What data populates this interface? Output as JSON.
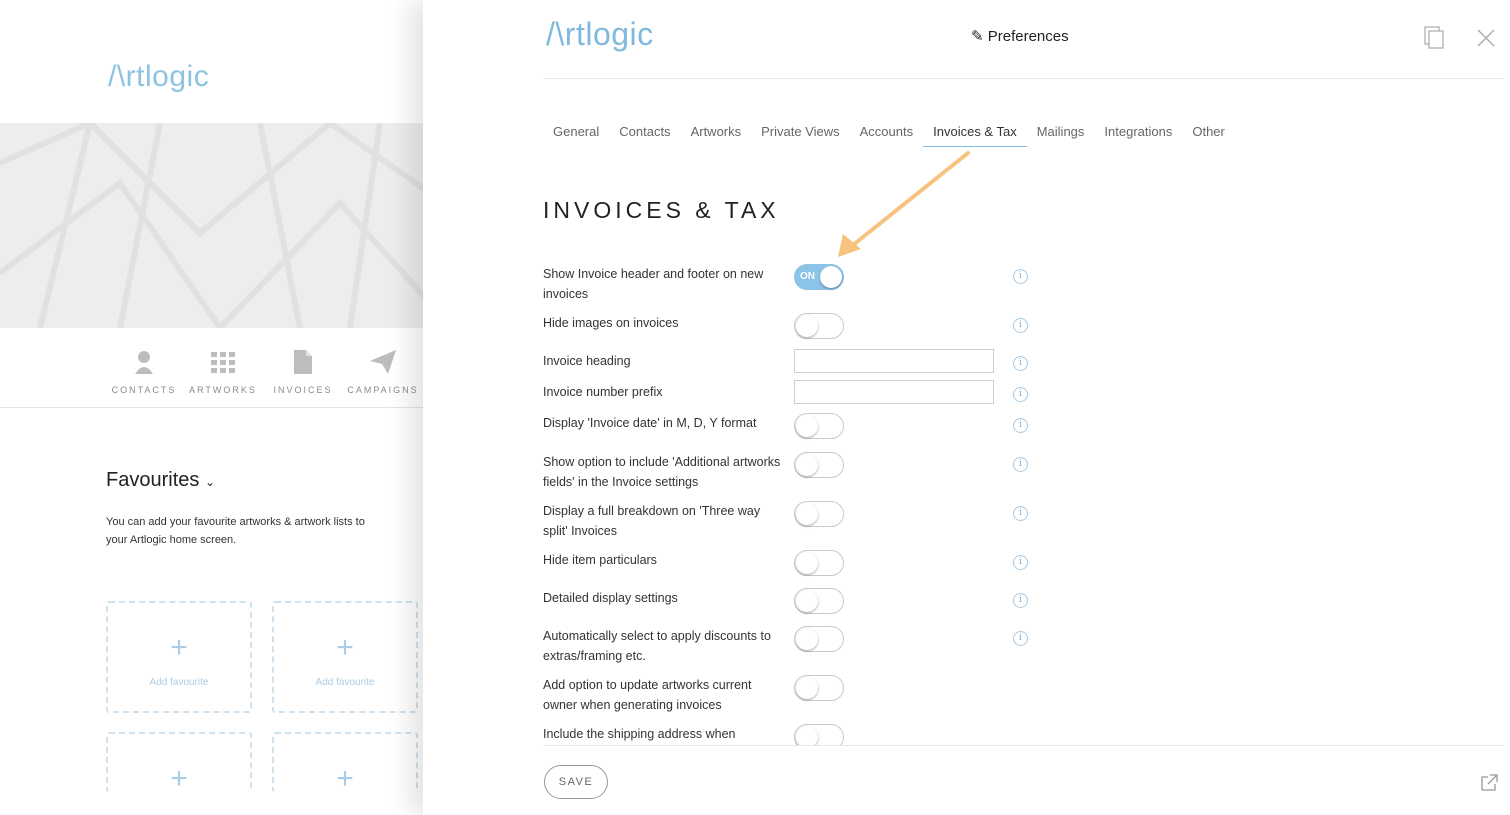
{
  "background_app": {
    "logo": "/\\rtlogic",
    "nav": [
      {
        "label": "CONTACTS",
        "icon": "person-icon"
      },
      {
        "label": "ARTWORKS",
        "icon": "grid-icon"
      },
      {
        "label": "INVOICES",
        "icon": "document-icon"
      },
      {
        "label": "CAMPAIGNS",
        "icon": "paper-plane-icon"
      }
    ],
    "favourites": {
      "title": "Favourites",
      "description": "You can add your favourite artworks & artwork lists to your Artlogic home screen.",
      "add_label": "Add favourite"
    }
  },
  "panel": {
    "logo": "/\\rtlogic",
    "title": "✎ Preferences",
    "tabs": [
      {
        "label": "General",
        "active": false
      },
      {
        "label": "Contacts",
        "active": false
      },
      {
        "label": "Artworks",
        "active": false
      },
      {
        "label": "Private Views",
        "active": false
      },
      {
        "label": "Accounts",
        "active": false
      },
      {
        "label": "Invoices & Tax",
        "active": true
      },
      {
        "label": "Mailings",
        "active": false
      },
      {
        "label": "Integrations",
        "active": false
      },
      {
        "label": "Other",
        "active": false
      }
    ],
    "section_title": "INVOICES & TAX",
    "settings": [
      {
        "label": "Show Invoice header and footer on new invoices",
        "control": "toggle",
        "value": "on",
        "on_text": "ON",
        "info": true
      },
      {
        "label": "Hide images on invoices",
        "control": "toggle",
        "value": "off",
        "info": true
      },
      {
        "label": "Invoice heading",
        "control": "text",
        "value": "",
        "info": true
      },
      {
        "label": "Invoice number prefix",
        "control": "text",
        "value": "",
        "info": true
      },
      {
        "label": "Display 'Invoice date' in M, D, Y format",
        "control": "toggle",
        "value": "off",
        "info": true
      },
      {
        "label": "Show option to include 'Additional artworks fields' in the Invoice settings",
        "control": "toggle",
        "value": "off",
        "info": true
      },
      {
        "label": "Display a full breakdown on 'Three way split' Invoices",
        "control": "toggle",
        "value": "off",
        "info": true
      },
      {
        "label": "Hide item particulars",
        "control": "toggle",
        "value": "off",
        "info": true
      },
      {
        "label": "Detailed display settings",
        "control": "toggle",
        "value": "off",
        "info": true
      },
      {
        "label": "Automatically select to apply discounts to extras/framing etc.",
        "control": "toggle",
        "value": "off",
        "info": true
      },
      {
        "label": "Add option to update artworks current owner when generating invoices",
        "control": "toggle",
        "value": "off",
        "info": false
      },
      {
        "label": "Include the shipping address when",
        "control": "toggle",
        "value": "off",
        "info": false
      }
    ],
    "info_glyph": "i",
    "save_label": "SAVE",
    "icons": {
      "copy": "copy-icon",
      "close": "close-icon",
      "external": "external-link-icon"
    },
    "accent_color": "#7fb9de",
    "arrow_color": "#f7c27e"
  }
}
